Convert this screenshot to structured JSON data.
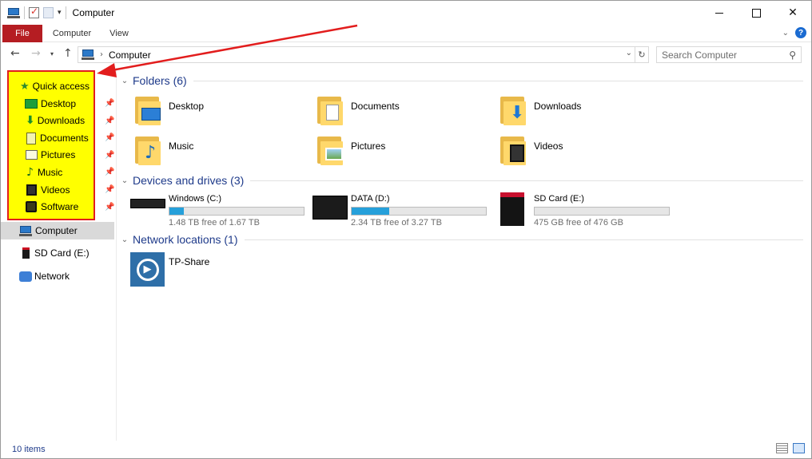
{
  "window": {
    "title": "Computer"
  },
  "ribbon": {
    "tabs": [
      "File",
      "Computer",
      "View"
    ]
  },
  "address": {
    "crumb": "Computer"
  },
  "search": {
    "placeholder": "Search Computer"
  },
  "nav": {
    "quick_access": {
      "label": "Quick access",
      "items": [
        {
          "label": "Desktop",
          "icon": "desktop-icon"
        },
        {
          "label": "Downloads",
          "icon": "downloads-icon"
        },
        {
          "label": "Documents",
          "icon": "documents-icon"
        },
        {
          "label": "Pictures",
          "icon": "pictures-icon"
        },
        {
          "label": "Music",
          "icon": "music-icon"
        },
        {
          "label": "Videos",
          "icon": "videos-icon"
        },
        {
          "label": "Software",
          "icon": "software-icon"
        }
      ]
    },
    "computer": "Computer",
    "sd_card": "SD Card (E:)",
    "network": "Network"
  },
  "groups": {
    "folders": {
      "title": "Folders (6)",
      "items": [
        "Desktop",
        "Documents",
        "Downloads",
        "Music",
        "Pictures",
        "Videos"
      ]
    },
    "drives": {
      "title": "Devices and drives (3)",
      "items": [
        {
          "name": "Windows (C:)",
          "free": "1.48 TB free of 1.67 TB",
          "used_fraction": 0.11
        },
        {
          "name": "DATA (D:)",
          "free": "2.34 TB free of 3.27 TB",
          "used_fraction": 0.28
        },
        {
          "name": "SD Card (E:)",
          "free": "475 GB free of 476 GB",
          "used_fraction": 0.0
        }
      ]
    },
    "network": {
      "title": "Network locations (1)",
      "items": [
        "TP-Share"
      ]
    }
  },
  "status": {
    "count": "10 items"
  },
  "colors": {
    "accent": "#b51d22",
    "drive_fill": "#26a0da",
    "group_title": "#1e3a8a",
    "highlight": "#ffff00",
    "annotation": "#e21d1d"
  }
}
